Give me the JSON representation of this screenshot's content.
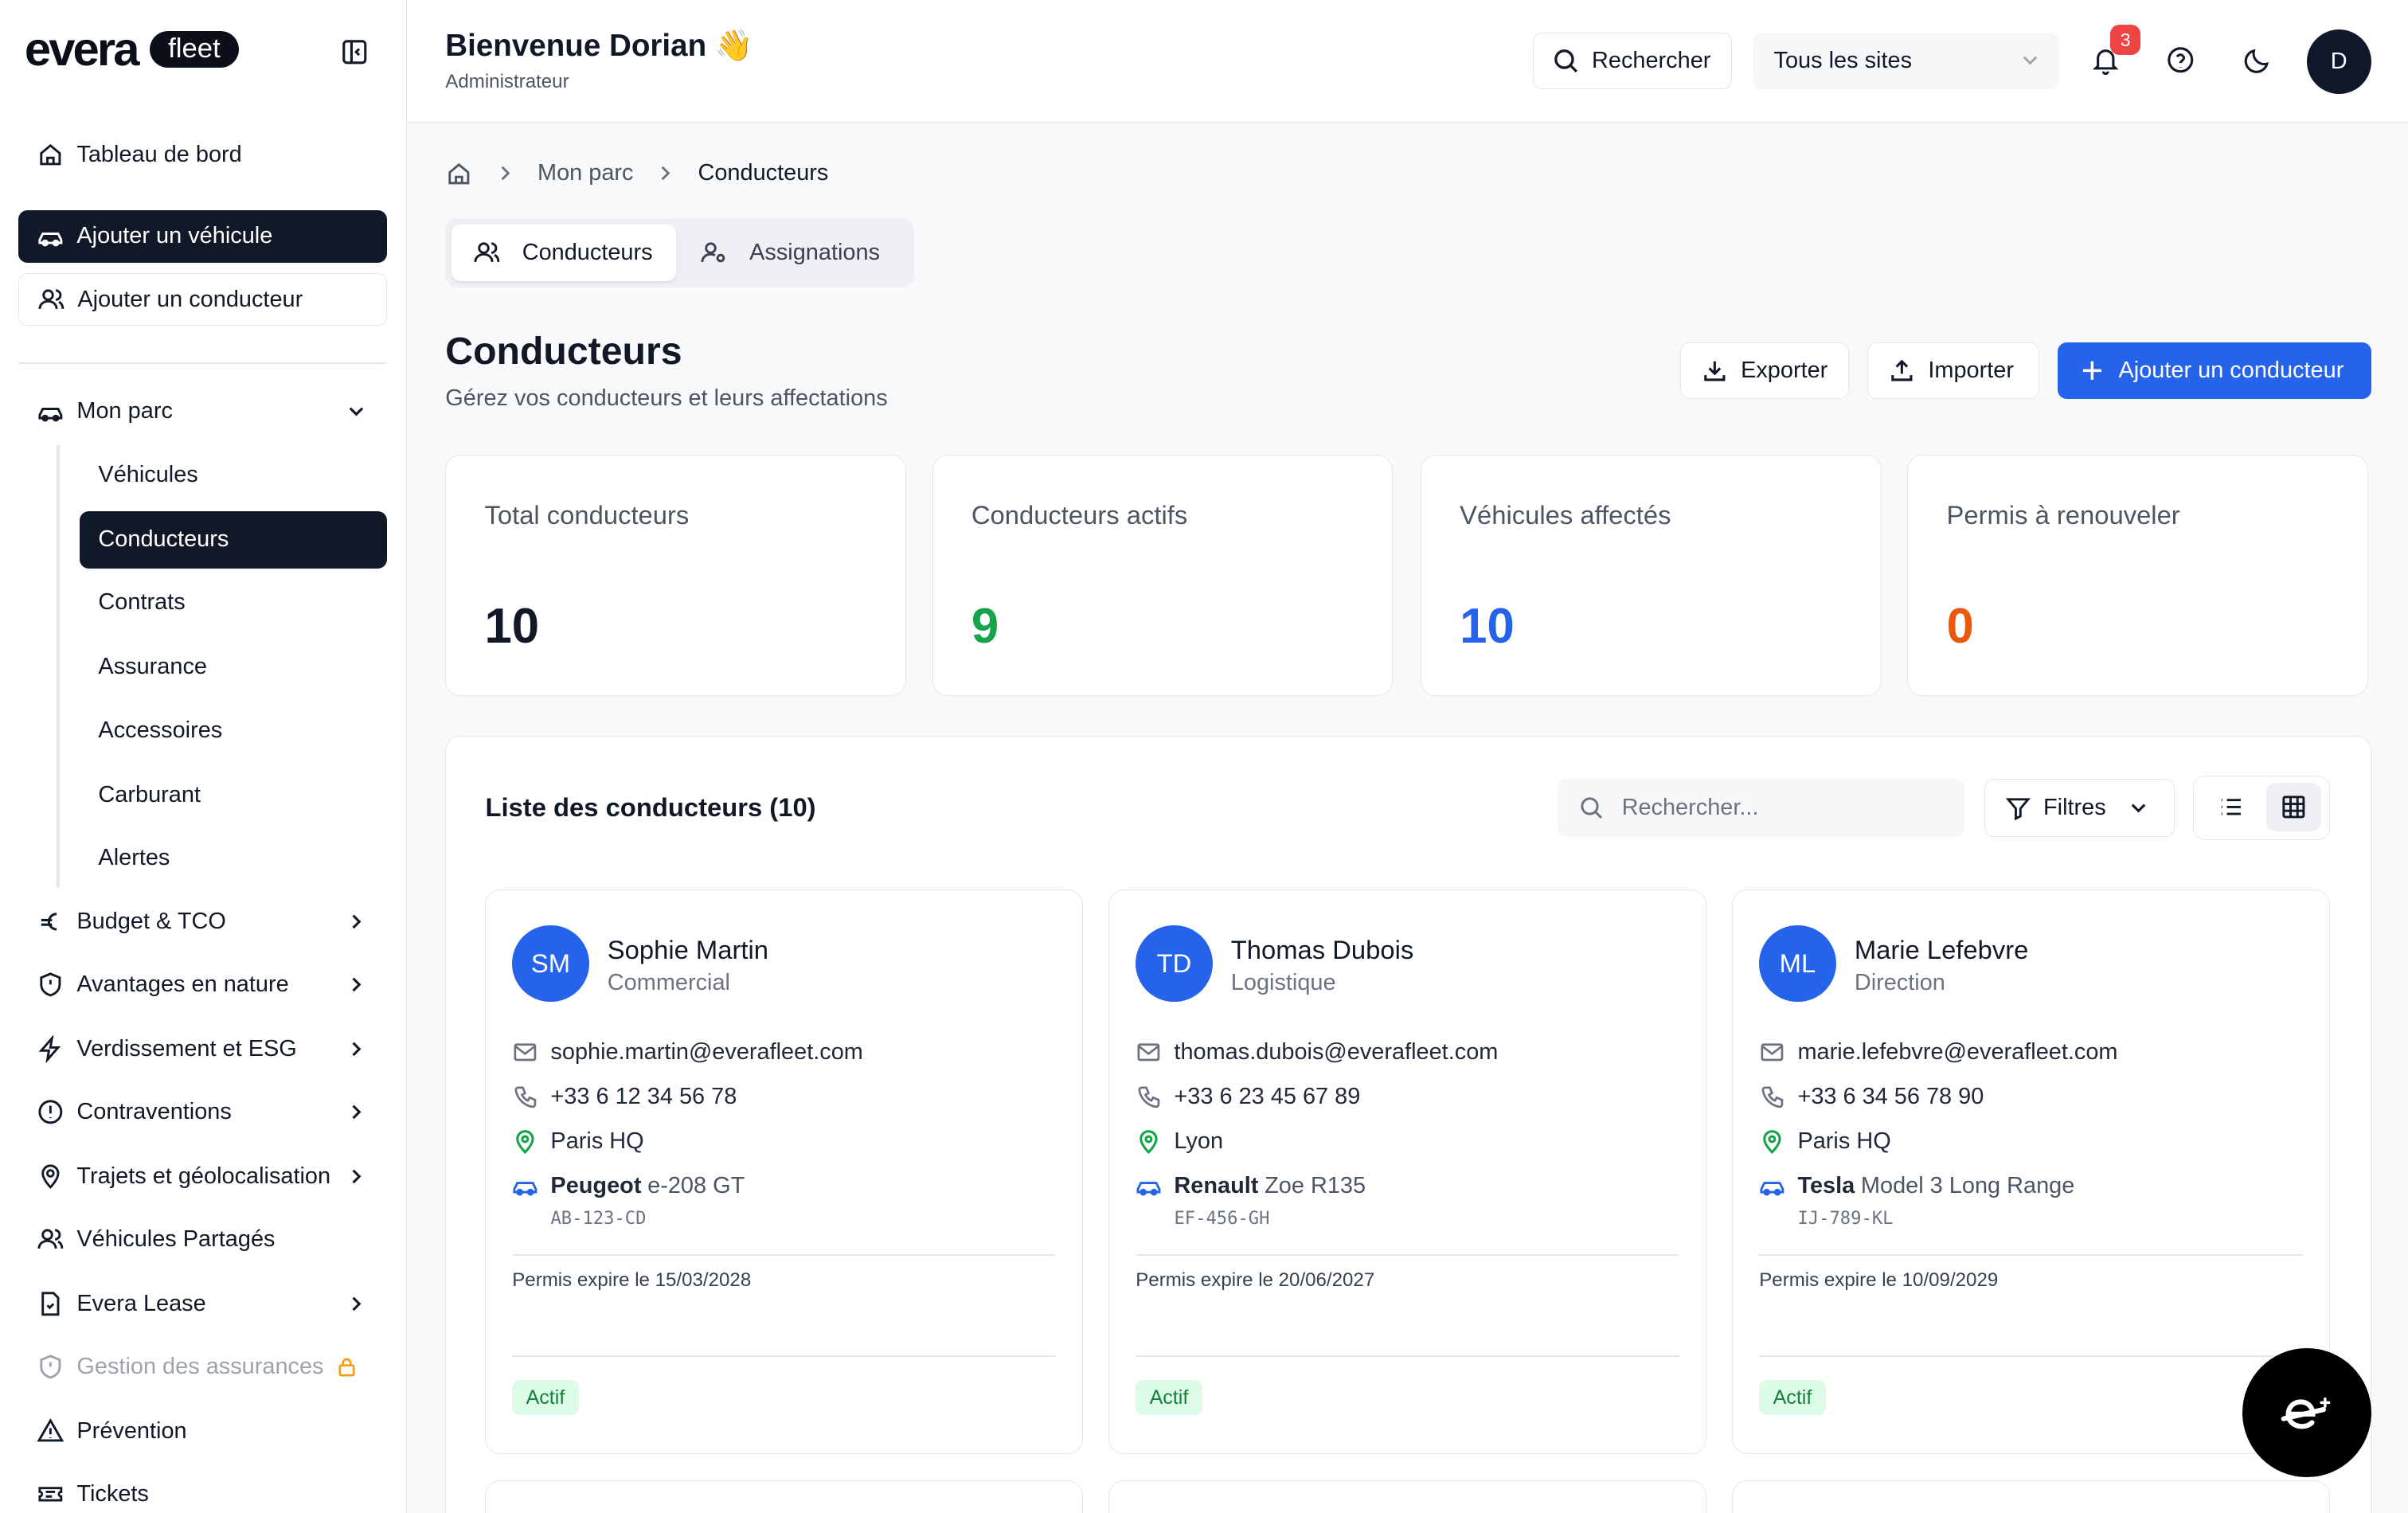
{
  "brand": {
    "logo": "evera",
    "product": "fleet"
  },
  "sidebar": {
    "dashboard": "Tableau de bord",
    "add_vehicle": "Ajouter un véhicule",
    "add_driver": "Ajouter un conducteur",
    "fleet_group": "Mon parc",
    "fleet_items": [
      "Véhicules",
      "Conducteurs",
      "Contrats",
      "Assurance",
      "Accessoires",
      "Carburant",
      "Alertes"
    ],
    "active_item": "Conducteurs",
    "groups": [
      "Budget & TCO",
      "Avantages en nature",
      "Verdissement et ESG",
      "Contraventions",
      "Trajets et géolocalisation",
      "Véhicules Partagés",
      "Evera Lease",
      "Gestion des assurances",
      "Prévention",
      "Tickets"
    ]
  },
  "topbar": {
    "greeting": "Bienvenue Dorian 👋",
    "role": "Administrateur",
    "search_label": "Rechercher",
    "site_select": "Tous les sites",
    "notification_count": "3",
    "avatar_initial": "D"
  },
  "breadcrumb": {
    "parent": "Mon parc",
    "current": "Conducteurs"
  },
  "tabs": {
    "drivers": "Conducteurs",
    "assignments": "Assignations"
  },
  "page": {
    "title": "Conducteurs",
    "subtitle": "Gérez vos conducteurs et leurs affectations",
    "export": "Exporter",
    "import": "Importer",
    "add": "Ajouter un conducteur"
  },
  "stats": [
    {
      "label": "Total conducteurs",
      "value": "10",
      "color": "#111827"
    },
    {
      "label": "Conducteurs actifs",
      "value": "9",
      "color": "#16a34a"
    },
    {
      "label": "Véhicules affectés",
      "value": "10",
      "color": "#2563eb"
    },
    {
      "label": "Permis à renouveler",
      "value": "0",
      "color": "#ea580c"
    }
  ],
  "list": {
    "title": "Liste des conducteurs (10)",
    "search_placeholder": "Rechercher...",
    "filters": "Filtres"
  },
  "drivers": [
    {
      "initials": "SM",
      "name": "Sophie Martin",
      "role": "Commercial",
      "email": "sophie.martin@everafleet.com",
      "phone": "+33 6 12 34 56 78",
      "site": "Paris HQ",
      "brand": "Peugeot",
      "model": "e-208 GT",
      "plate": "AB-123-CD",
      "permit": "Permis expire le 15/03/2028",
      "status": "Actif"
    },
    {
      "initials": "TD",
      "name": "Thomas Dubois",
      "role": "Logistique",
      "email": "thomas.dubois@everafleet.com",
      "phone": "+33 6 23 45 67 89",
      "site": "Lyon",
      "brand": "Renault",
      "model": "Zoe R135",
      "plate": "EF-456-GH",
      "permit": "Permis expire le 20/06/2027",
      "status": "Actif"
    },
    {
      "initials": "ML",
      "name": "Marie Lefebvre",
      "role": "Direction",
      "email": "marie.lefebvre@everafleet.com",
      "phone": "+33 6 34 56 78 90",
      "site": "Paris HQ",
      "brand": "Tesla",
      "model": "Model 3 Long Range",
      "plate": "IJ-789-KL",
      "permit": "Permis expire le 10/09/2029",
      "status": "Actif"
    }
  ],
  "colors": {
    "primary": "#2563eb",
    "dark": "#111827",
    "success": "#16a34a",
    "warning": "#ea580c"
  }
}
